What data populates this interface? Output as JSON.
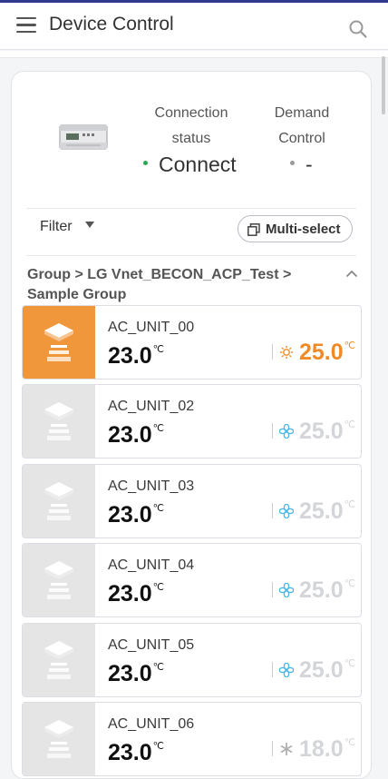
{
  "header": {
    "title": "Device Control"
  },
  "status": {
    "connection_label": "Connection status",
    "connection_value": "Connect",
    "connection_color": "#2aa952",
    "demand_label": "Demand Control",
    "demand_value": "-",
    "demand_color": "#999999"
  },
  "toolbar": {
    "filter_label": "Filter",
    "multi_select_label": "Multi-select"
  },
  "breadcrumb": "Group > LG Vnet_BECON_ACP_Test > Sample Group",
  "units": [
    {
      "name": "AC_UNIT_00",
      "current": "23.0",
      "setpoint": "25.0",
      "unit": "℃",
      "mode": "heat-icon",
      "active": true
    },
    {
      "name": "AC_UNIT_02",
      "current": "23.0",
      "setpoint": "25.0",
      "unit": "℃",
      "mode": "fan-icon",
      "active": false
    },
    {
      "name": "AC_UNIT_03",
      "current": "23.0",
      "setpoint": "25.0",
      "unit": "℃",
      "mode": "fan-icon",
      "active": false
    },
    {
      "name": "AC_UNIT_04",
      "current": "23.0",
      "setpoint": "25.0",
      "unit": "℃",
      "mode": "fan-icon",
      "active": false
    },
    {
      "name": "AC_UNIT_05",
      "current": "23.0",
      "setpoint": "25.0",
      "unit": "℃",
      "mode": "fan-icon",
      "active": false
    },
    {
      "name": "AC_UNIT_06",
      "current": "23.0",
      "setpoint": "18.0",
      "unit": "℃",
      "mode": "cool-icon",
      "active": false
    }
  ],
  "colors": {
    "accent": "#f0973b",
    "fan": "#4db8e8",
    "cool": "#b0b0b0"
  }
}
